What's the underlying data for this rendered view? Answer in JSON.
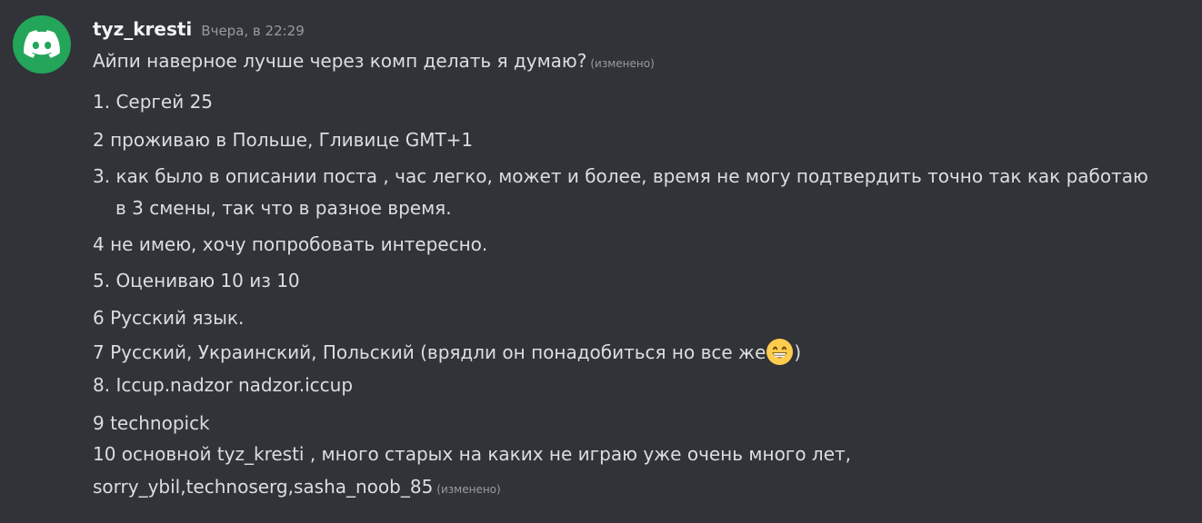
{
  "message": {
    "avatar_icon": "discord-logo-icon",
    "avatar_color": "#23a55a",
    "username": "tyz_kresti",
    "timestamp": "Вчера, в 22:29",
    "edited_label": "(изменено)",
    "lines": [
      "Айпи наверное лучше через комп делать я думаю?",
      "1. Сергей 25",
      "2 проживаю в Польше, Гливице GMT+1",
      "3. как было в описании поста , час легко, может и более, время не могу подтвердить точно так как работаю",
      "в 3 смены, так что в разное время.",
      "4 не имею, хочу попробовать интересно.",
      "5. Оцениваю 10 из 10",
      "6 Русский язык.",
      "7 Русский, Украинский, Польский (врядли он понадобиться но все же",
      ")",
      "8. Iccup.nadzor nadzor.iccup",
      "9 technopick",
      "10 основной tyz_kresti , много старых на каких не играю уже очень много лет,",
      "sorry_ybil,technoserg,sasha_noob_85"
    ],
    "emoji_icon": "grinning-face-emoji-icon"
  }
}
